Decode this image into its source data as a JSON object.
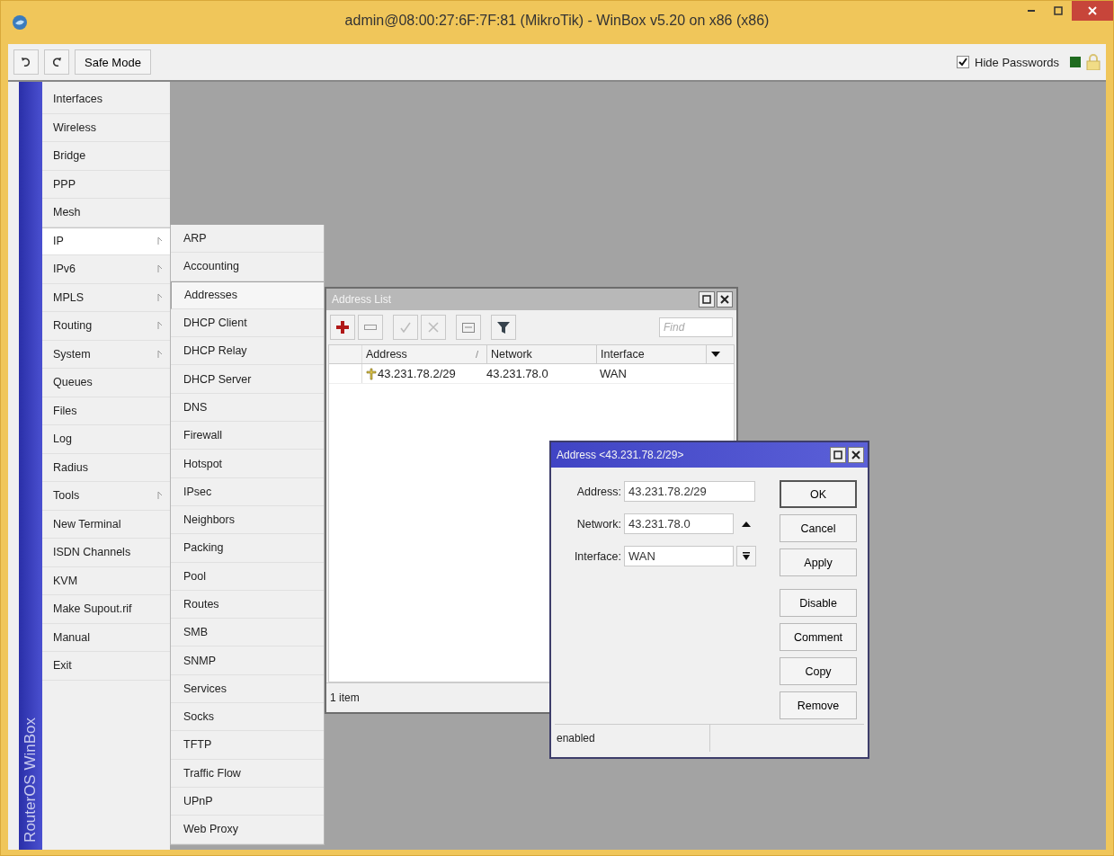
{
  "window": {
    "title": "admin@08:00:27:6F:7F:81 (MikroTik) - WinBox v5.20 on x86 (x86)"
  },
  "toolbar": {
    "safe_mode": "Safe Mode",
    "hide_passwords": {
      "label": "Hide Passwords",
      "checked": true
    }
  },
  "sidebar": {
    "brand": "RouterOS WinBox",
    "items": [
      {
        "label": "Interfaces",
        "has_submenu": false,
        "selected": false
      },
      {
        "label": "Wireless",
        "has_submenu": false,
        "selected": false
      },
      {
        "label": "Bridge",
        "has_submenu": false,
        "selected": false
      },
      {
        "label": "PPP",
        "has_submenu": false,
        "selected": false
      },
      {
        "label": "Mesh",
        "has_submenu": false,
        "selected": false
      },
      {
        "label": "IP",
        "has_submenu": true,
        "selected": true
      },
      {
        "label": "IPv6",
        "has_submenu": true,
        "selected": false
      },
      {
        "label": "MPLS",
        "has_submenu": true,
        "selected": false
      },
      {
        "label": "Routing",
        "has_submenu": true,
        "selected": false
      },
      {
        "label": "System",
        "has_submenu": true,
        "selected": false
      },
      {
        "label": "Queues",
        "has_submenu": false,
        "selected": false
      },
      {
        "label": "Files",
        "has_submenu": false,
        "selected": false
      },
      {
        "label": "Log",
        "has_submenu": false,
        "selected": false
      },
      {
        "label": "Radius",
        "has_submenu": false,
        "selected": false
      },
      {
        "label": "Tools",
        "has_submenu": true,
        "selected": false
      },
      {
        "label": "New Terminal",
        "has_submenu": false,
        "selected": false
      },
      {
        "label": "ISDN Channels",
        "has_submenu": false,
        "selected": false
      },
      {
        "label": "KVM",
        "has_submenu": false,
        "selected": false
      },
      {
        "label": "Make Supout.rif",
        "has_submenu": false,
        "selected": false
      },
      {
        "label": "Manual",
        "has_submenu": false,
        "selected": false
      },
      {
        "label": "Exit",
        "has_submenu": false,
        "selected": false
      }
    ]
  },
  "submenu": {
    "items": [
      {
        "label": "ARP",
        "selected": false
      },
      {
        "label": "Accounting",
        "selected": false
      },
      {
        "label": "Addresses",
        "selected": true
      },
      {
        "label": "DHCP Client",
        "selected": false
      },
      {
        "label": "DHCP Relay",
        "selected": false
      },
      {
        "label": "DHCP Server",
        "selected": false
      },
      {
        "label": "DNS",
        "selected": false
      },
      {
        "label": "Firewall",
        "selected": false
      },
      {
        "label": "Hotspot",
        "selected": false
      },
      {
        "label": "IPsec",
        "selected": false
      },
      {
        "label": "Neighbors",
        "selected": false
      },
      {
        "label": "Packing",
        "selected": false
      },
      {
        "label": "Pool",
        "selected": false
      },
      {
        "label": "Routes",
        "selected": false
      },
      {
        "label": "SMB",
        "selected": false
      },
      {
        "label": "SNMP",
        "selected": false
      },
      {
        "label": "Services",
        "selected": false
      },
      {
        "label": "Socks",
        "selected": false
      },
      {
        "label": "TFTP",
        "selected": false
      },
      {
        "label": "Traffic Flow",
        "selected": false
      },
      {
        "label": "UPnP",
        "selected": false
      },
      {
        "label": "Web Proxy",
        "selected": false
      }
    ]
  },
  "address_list": {
    "title": "Address List",
    "active": false,
    "find_placeholder": "Find",
    "columns": [
      "Address",
      "Network",
      "Interface"
    ],
    "sort_mark": "/",
    "rows": [
      {
        "address": "43.231.78.2/29",
        "network": "43.231.78.0",
        "interface": "WAN"
      }
    ],
    "status": "1 item"
  },
  "dialog": {
    "title": "Address <43.231.78.2/29>",
    "active": true,
    "fields": [
      {
        "label": "Address:",
        "value": "43.231.78.2/29",
        "kind": "text"
      },
      {
        "label": "Network:",
        "value": "43.231.78.0",
        "kind": "toggle"
      },
      {
        "label": "Interface:",
        "value": "WAN",
        "kind": "select"
      }
    ],
    "buttons": [
      {
        "label": "OK",
        "default": true
      },
      {
        "label": "Cancel",
        "default": false
      },
      {
        "label": "Apply",
        "default": false
      }
    ],
    "actions": [
      {
        "label": "Disable"
      },
      {
        "label": "Comment"
      },
      {
        "label": "Copy"
      },
      {
        "label": "Remove"
      }
    ],
    "status": "enabled"
  }
}
